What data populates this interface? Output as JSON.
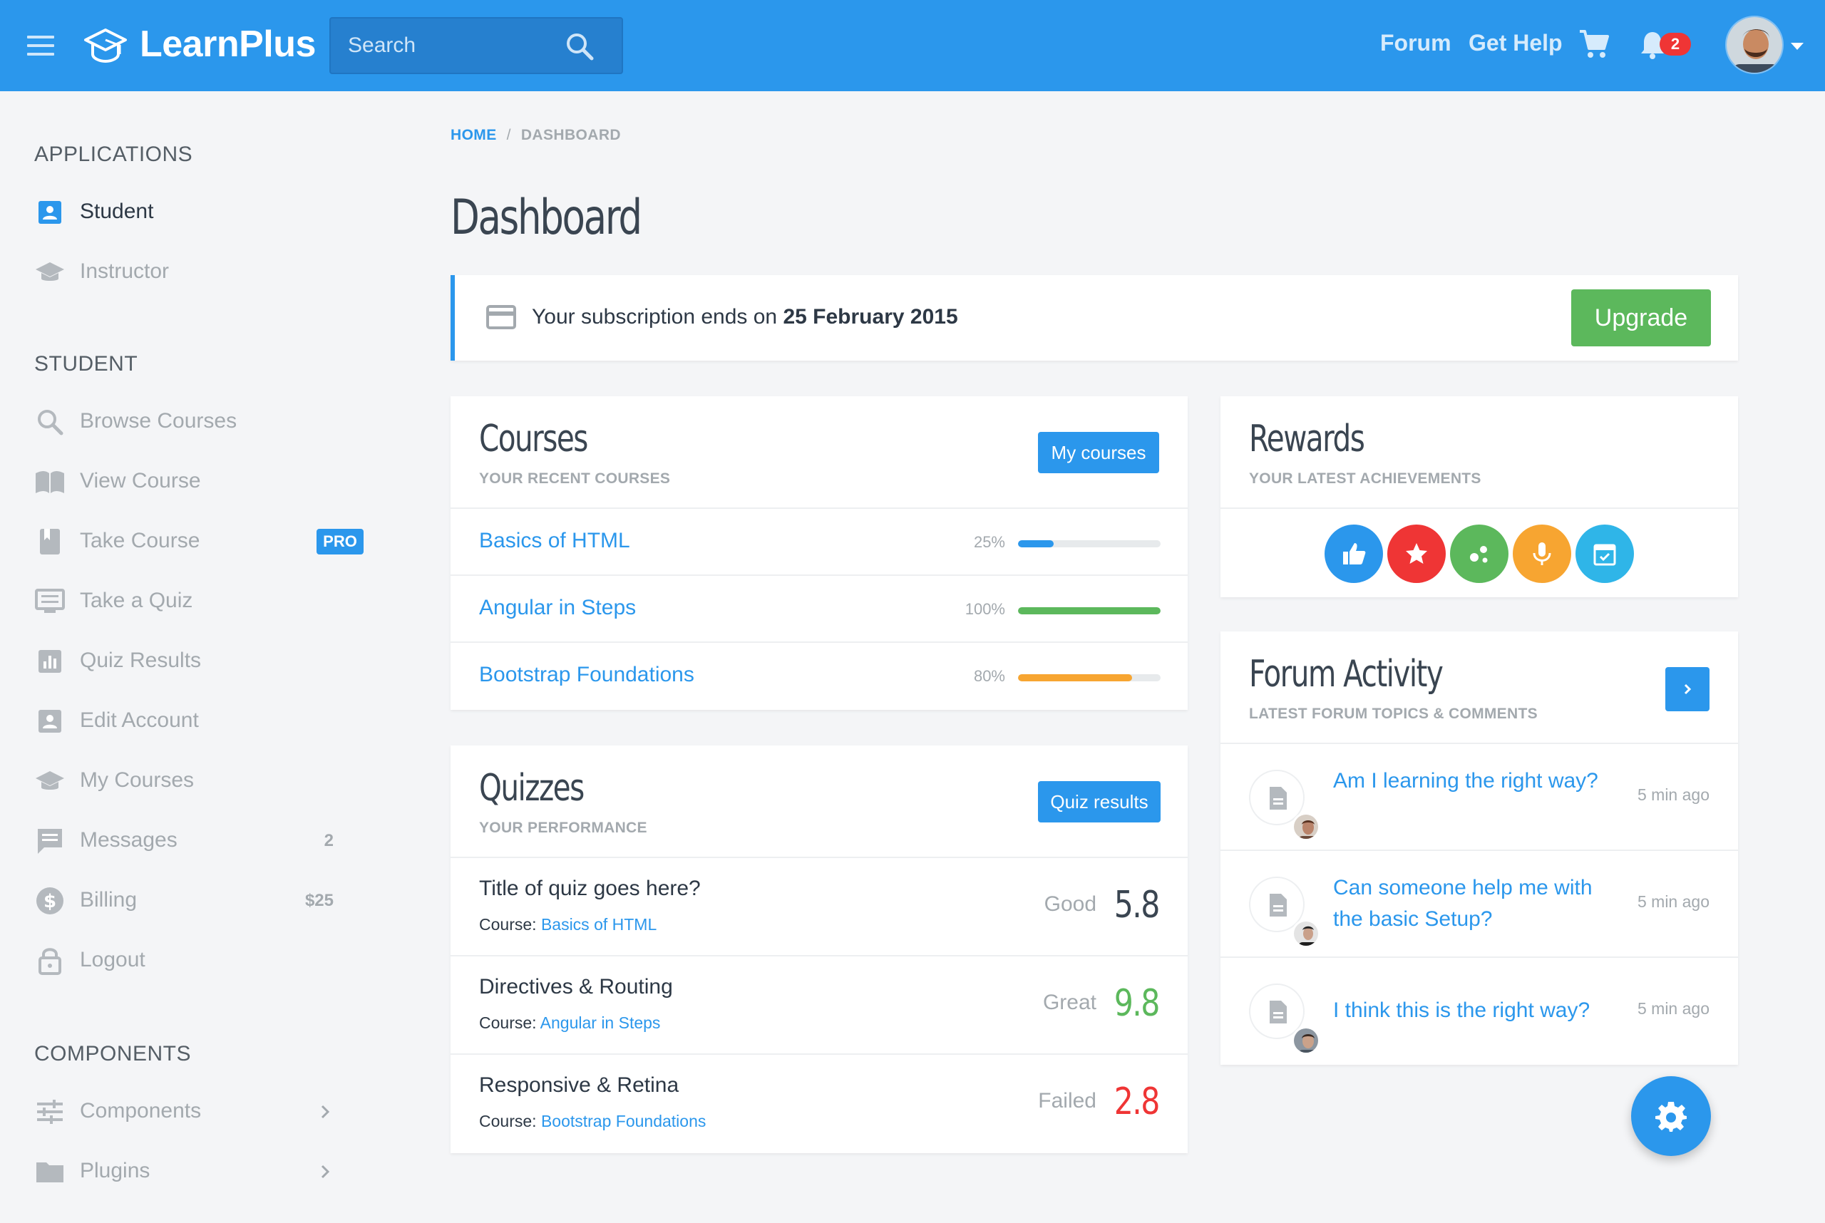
{
  "brand": "LearnPlus",
  "search": {
    "placeholder": "Search"
  },
  "topnav": {
    "forum": "Forum",
    "help": "Get Help",
    "notifications": "2"
  },
  "sidebar": {
    "applications_title": "APPLICATIONS",
    "applications": [
      {
        "label": "Student",
        "icon": "account-box-icon"
      },
      {
        "label": "Instructor",
        "icon": "graduation-cap-icon"
      }
    ],
    "student_title": "STUDENT",
    "student": [
      {
        "label": "Browse Courses",
        "icon": "search-icon"
      },
      {
        "label": "View Course",
        "icon": "book-open-icon"
      },
      {
        "label": "Take Course",
        "icon": "bookmark-icon",
        "badge": "PRO"
      },
      {
        "label": "Take a Quiz",
        "icon": "monitor-icon"
      },
      {
        "label": "Quiz Results",
        "icon": "bar-chart-icon"
      },
      {
        "label": "Edit Account",
        "icon": "account-box-icon"
      },
      {
        "label": "My Courses",
        "icon": "graduation-cap-icon"
      },
      {
        "label": "Messages",
        "icon": "message-icon",
        "meta": "2"
      },
      {
        "label": "Billing",
        "icon": "dollar-icon",
        "meta": "$25"
      },
      {
        "label": "Logout",
        "icon": "lock-icon"
      }
    ],
    "components_title": "COMPONENTS",
    "components": [
      {
        "label": "Components",
        "icon": "tune-icon"
      },
      {
        "label": "Plugins",
        "icon": "folder-icon"
      }
    ]
  },
  "breadcrumb": {
    "home": "HOME",
    "current": "DASHBOARD"
  },
  "page_title": "Dashboard",
  "subscription": {
    "prefix": "Your subscription ends on ",
    "date": "25 February 2015",
    "button": "Upgrade"
  },
  "courses": {
    "title": "Courses",
    "subtitle": "YOUR RECENT COURSES",
    "button": "My courses",
    "items": [
      {
        "name": "Basics of HTML",
        "progress_label": "25%",
        "progress": 0.25,
        "color": "#2b97ec"
      },
      {
        "name": "Angular in Steps",
        "progress_label": "100%",
        "progress": 1.0,
        "color": "#5cb85c"
      },
      {
        "name": "Bootstrap Foundations",
        "progress_label": "80%",
        "progress": 0.8,
        "color": "#f7a531"
      }
    ]
  },
  "quizzes": {
    "title": "Quizzes",
    "subtitle": "YOUR PERFORMANCE",
    "button": "Quiz results",
    "course_prefix": "Course: ",
    "items": [
      {
        "title": "Title of quiz goes here?",
        "course": "Basics of HTML",
        "verdict": "Good",
        "score": "5.8",
        "color": "#3a4551"
      },
      {
        "title": "Directives & Routing",
        "course": "Angular in Steps",
        "verdict": "Great",
        "score": "9.8",
        "color": "#5cb85c"
      },
      {
        "title": "Responsive & Retina",
        "course": "Bootstrap Foundations",
        "verdict": "Failed",
        "score": "2.8",
        "color": "#ef3535"
      }
    ]
  },
  "rewards": {
    "title": "Rewards",
    "subtitle": "YOUR LATEST ACHIEVEMENTS",
    "items": [
      {
        "icon": "thumbs-up-icon",
        "color": "#2b97ec"
      },
      {
        "icon": "star-icon",
        "color": "#ef3535"
      },
      {
        "icon": "bubbles-icon",
        "color": "#5cb85c"
      },
      {
        "icon": "microphone-icon",
        "color": "#f7a531"
      },
      {
        "icon": "calendar-check-icon",
        "color": "#2fb5e8"
      }
    ]
  },
  "forum": {
    "title": "Forum Activity",
    "subtitle": "LATEST FORUM TOPICS & COMMENTS",
    "items": [
      {
        "title": "Am I learning the right way?",
        "time": "5 min ago"
      },
      {
        "title": "Can someone help me with the basic Setup?",
        "time": "5 min ago"
      },
      {
        "title": "I think this is the right way?",
        "time": "5 min ago"
      }
    ]
  },
  "colors": {
    "primary": "#2b97ec",
    "success": "#5cb85c",
    "warning": "#f7a531",
    "danger": "#ef3535"
  }
}
